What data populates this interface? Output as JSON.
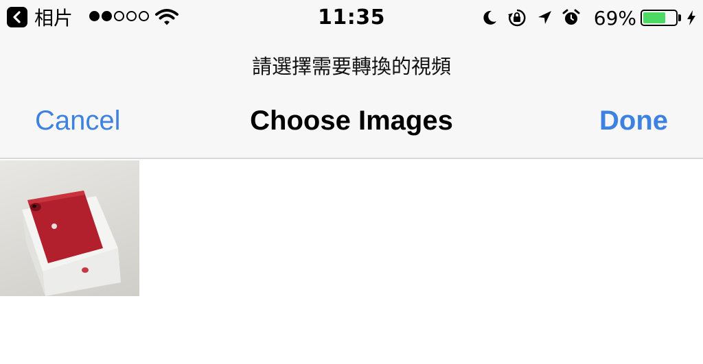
{
  "status_bar": {
    "back_app_label": "相片",
    "time": "11:35",
    "battery_percent": "69%",
    "battery_level": 0.69,
    "signal_bars_filled": 2,
    "signal_bars_total": 5,
    "icons": [
      "chevron-left-icon",
      "wifi-icon",
      "moon-icon",
      "rotation-lock-icon",
      "location-arrow-icon",
      "alarm-clock-icon",
      "battery-icon",
      "charging-bolt-icon"
    ]
  },
  "prompt": "請選擇需要轉換的視頻",
  "nav": {
    "cancel_label": "Cancel",
    "title": "Choose Images",
    "done_label": "Done"
  },
  "colors": {
    "accent": "#3d82e0",
    "battery": "#4cd964",
    "chrome_bg": "#f7f7f7"
  },
  "photos": [
    {
      "subject": "red iPhone box",
      "icon": "photo-thumbnail"
    }
  ]
}
